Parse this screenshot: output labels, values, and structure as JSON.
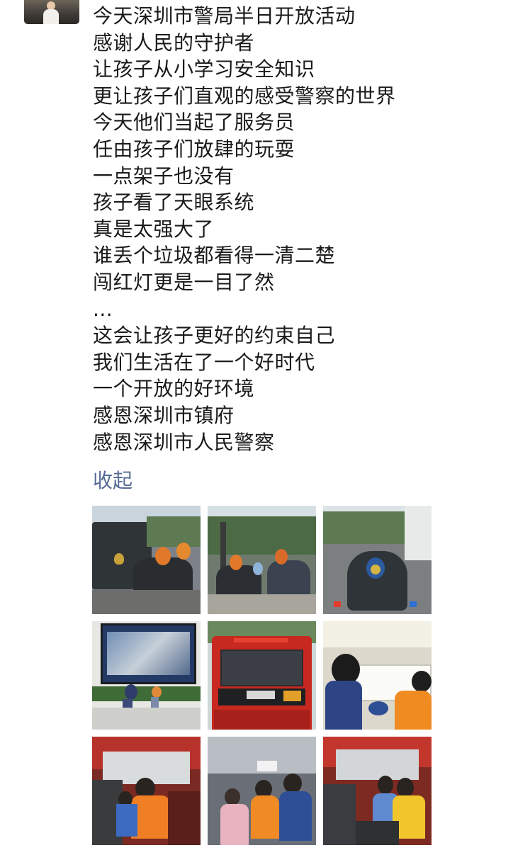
{
  "post": {
    "lines": [
      "今天深圳市警局半日开放活动",
      "感谢人民的守护者",
      "让孩子从小学习安全知识",
      "更让孩子们直观的感受警察的世界",
      "今天他们当起了服务员",
      "任由孩子们放肆的玩耍",
      "一点架子也没有",
      "孩子看了天眼系统",
      "真是太强大了",
      "谁丢个垃圾都看得一清二楚",
      "闯红灯更是一目了然",
      "...",
      "这会让孩子更好的约束自己",
      "我们生活在了一个好时代",
      "一个开放的好环境",
      "感恩深圳市镇府",
      "感恩深圳市人民警察"
    ],
    "collapse_label": "收起"
  },
  "colors": {
    "link": "#576b95",
    "text": "#1a1a1a",
    "background": "#ffffff"
  },
  "photos": [
    {
      "subject": "police-car-motorcycle"
    },
    {
      "subject": "kids-on-motorcycles"
    },
    {
      "subject": "police-motorcycle"
    },
    {
      "subject": "monitoring-screen"
    },
    {
      "subject": "fire-truck"
    },
    {
      "subject": "kids-in-vehicle"
    },
    {
      "subject": "kids-in-truck-cab"
    },
    {
      "subject": "kids-in-van"
    },
    {
      "subject": "kids-in-truck-cab-2"
    }
  ]
}
